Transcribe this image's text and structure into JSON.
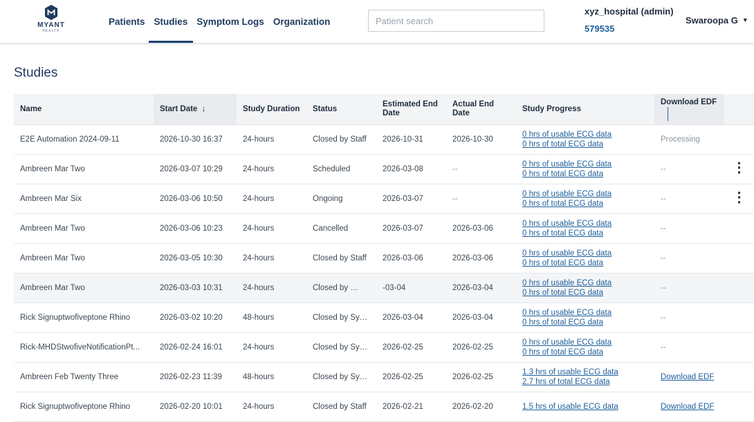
{
  "header": {
    "logo_text": "MYANT",
    "logo_subtext": "HEALTH",
    "nav": [
      {
        "label": "Patients",
        "active": false
      },
      {
        "label": "Studies",
        "active": true
      },
      {
        "label": "Symptom Logs",
        "active": false
      },
      {
        "label": "Organization",
        "active": false
      }
    ],
    "search_placeholder": "Patient search",
    "org_name": "xyz_hospital (admin)",
    "org_id": "579535",
    "user_name": "Swaroopa G"
  },
  "page_title": "Studies",
  "table": {
    "columns": [
      "Name",
      "Start Date",
      "Study Duration",
      "Status",
      "Estimated End Date",
      "Actual End Date",
      "Study Progress",
      "Download EDF"
    ],
    "sorted_column": "Start Date",
    "sort_direction": "descending",
    "rows": [
      {
        "name": "E2E Automation 2024-09-11",
        "start": "2026-10-30 16:37",
        "duration": "24-hours",
        "status": "Closed by Staff",
        "est_end": "2026-10-31",
        "actual_end": "2026-10-30",
        "usable": "0 hrs of usable ECG data",
        "total": "0 hrs of total ECG data",
        "download": "Processing",
        "download_type": "muted",
        "menu": false
      },
      {
        "name": "Ambreen Mar Two",
        "start": "2026-03-07 10:29",
        "duration": "24-hours",
        "status": "Scheduled",
        "est_end": "2026-03-08",
        "actual_end": "--",
        "usable": "0 hrs of usable ECG data",
        "total": "0 hrs of total ECG data",
        "download": "--",
        "download_type": "muted",
        "menu": true
      },
      {
        "name": "Ambreen Mar Six",
        "start": "2026-03-06 10:50",
        "duration": "24-hours",
        "status": "Ongoing",
        "est_end": "2026-03-07",
        "actual_end": "--",
        "usable": "0 hrs of usable ECG data",
        "total": "0 hrs of total ECG data",
        "download": "--",
        "download_type": "muted",
        "menu": true
      },
      {
        "name": "Ambreen Mar Two",
        "start": "2026-03-06 10:23",
        "duration": "24-hours",
        "status": "Cancelled",
        "est_end": "2026-03-07",
        "actual_end": "2026-03-06",
        "usable": "0 hrs of usable ECG data",
        "total": "0 hrs of total ECG data",
        "download": "--",
        "download_type": "muted",
        "menu": false
      },
      {
        "name": "Ambreen Mar Two",
        "start": "2026-03-05 10:30",
        "duration": "24-hours",
        "status": "Closed by Staff",
        "est_end": "2026-03-06",
        "actual_end": "2026-03-06",
        "usable": "0 hrs of usable ECG data",
        "total": "0 hrs of total ECG data",
        "download": "--",
        "download_type": "muted",
        "menu": false
      },
      {
        "name": "Ambreen Mar Two",
        "start": "2026-03-03 10:31",
        "duration": "24-hours",
        "status": "Closed by",
        "tooltip": "Closed by Staff",
        "est_end": "-03-04",
        "actual_end": "2026-03-04",
        "usable": "0 hrs of usable ECG data",
        "total": "0 hrs of total ECG data",
        "download": "--",
        "download_type": "muted",
        "menu": false,
        "highlight": true
      },
      {
        "name": "Rick Signuptwofiveptone Rhino",
        "start": "2026-03-02 10:20",
        "duration": "48-hours",
        "status": "Closed by Sys...",
        "est_end": "2026-03-04",
        "actual_end": "2026-03-04",
        "usable": "0 hrs of usable ECG data",
        "total": "0 hrs of total ECG data",
        "download": "--",
        "download_type": "muted",
        "menu": false
      },
      {
        "name": "Rick-MHDStwofiveNotificationPt...",
        "start": "2026-02-24 16:01",
        "duration": "24-hours",
        "status": "Closed by Sys...",
        "est_end": "2026-02-25",
        "actual_end": "2026-02-25",
        "usable": "0 hrs of usable ECG data",
        "total": "0 hrs of total ECG data",
        "download": "--",
        "download_type": "muted",
        "menu": false
      },
      {
        "name": "Ambreen Feb Twenty Three",
        "start": "2026-02-23 11:39",
        "duration": "48-hours",
        "status": "Closed by Sys...",
        "est_end": "2026-02-25",
        "actual_end": "2026-02-25",
        "usable": "1.3 hrs of usable ECG data",
        "total": "2.7 hrs of total ECG data",
        "download": "Download EDF",
        "download_type": "link",
        "menu": false
      },
      {
        "name": "Rick Signuptwofiveptone Rhino",
        "start": "2026-02-20 10:01",
        "duration": "24-hours",
        "status": "Closed by Staff",
        "est_end": "2026-02-21",
        "actual_end": "2026-02-20",
        "usable": "1.5 hrs of usable ECG data",
        "total": "",
        "download": "Download EDF",
        "download_type": "link",
        "menu": false
      }
    ]
  },
  "colors": {
    "brand": "#1e3a5f",
    "link": "#1e5f9a",
    "header_bg": "#f3f4f6"
  },
  "icons": {
    "sort": "arrow-down-icon",
    "row_menu": "kebab-menu-icon",
    "user_menu": "caret-down-icon"
  }
}
